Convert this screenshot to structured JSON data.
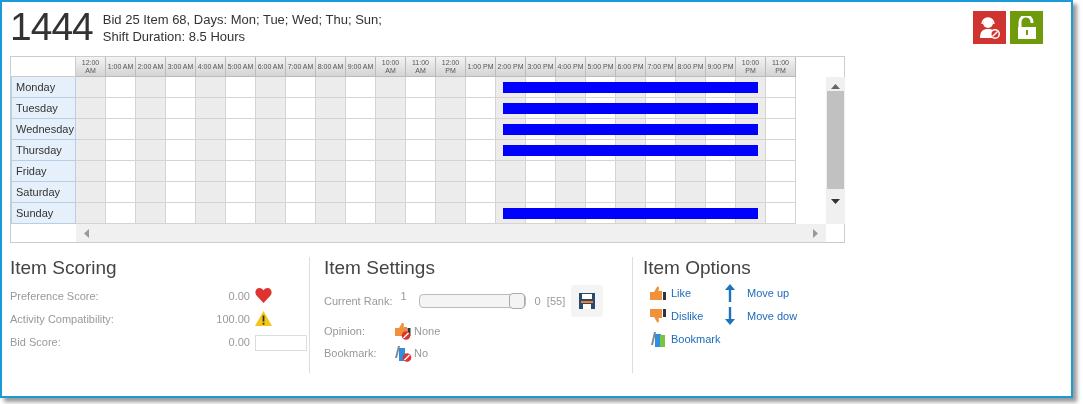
{
  "header": {
    "number": "1444",
    "lines": [
      "Bid 25 Item 68, Days: Mon; Tue; Wed; Thu; Sun;",
      "Shift Duration: 8.5 Hours"
    ]
  },
  "actions": [
    {
      "kind": "agent-blocked"
    },
    {
      "kind": "unlock"
    }
  ],
  "schedule": {
    "hours": [
      "12:00 AM",
      "1:00 AM",
      "2:00 AM",
      "3:00 AM",
      "4:00 AM",
      "5:00 AM",
      "6:00 AM",
      "7:00 AM",
      "8:00 AM",
      "9:00 AM",
      "10:00 AM",
      "11:00 AM",
      "12:00 PM",
      "1:00 PM",
      "2:00 PM",
      "3:00 PM",
      "4:00 PM",
      "5:00 PM",
      "6:00 PM",
      "7:00 PM",
      "8:00 PM",
      "9:00 PM",
      "10:00 PM",
      "11:00 PM"
    ],
    "days": [
      {
        "label": "Monday",
        "shift": true
      },
      {
        "label": "Tuesday",
        "shift": true
      },
      {
        "label": "Wednesday",
        "shift": true
      },
      {
        "label": "Thursday",
        "shift": true
      },
      {
        "label": "Friday",
        "shift": false
      },
      {
        "label": "Saturday",
        "shift": false
      },
      {
        "label": "Sunday",
        "shift": true
      }
    ]
  },
  "scoring": {
    "title": "Item Scoring",
    "rows": [
      {
        "label": "Preference Score:",
        "value": "0.00",
        "kind": "heart"
      },
      {
        "label": "Activity Compatibility:",
        "value": "100.00",
        "kind": "warning"
      },
      {
        "label": "Bid Score:",
        "value": "0.00",
        "kind": "field"
      }
    ]
  },
  "settings": {
    "title": "Item Settings",
    "rank": {
      "label": "Current Rank:",
      "min": "1",
      "level": 1,
      "value": "0",
      "total": "[55]"
    },
    "rows": [
      {
        "label": "Opinion:",
        "value": "None",
        "kind": "opinion"
      },
      {
        "label": "Bookmark:",
        "value": "No",
        "kind": "bookmark"
      }
    ]
  },
  "options": {
    "title": "Item Options",
    "items": [
      {
        "label": "Like",
        "kind": "like"
      },
      {
        "label": "Move up",
        "kind": "up"
      },
      {
        "label": "Dislike",
        "kind": "dislike"
      },
      {
        "label": "Move dow",
        "kind": "down"
      },
      {
        "label": "Bookmark",
        "kind": "bookmark"
      }
    ]
  }
}
